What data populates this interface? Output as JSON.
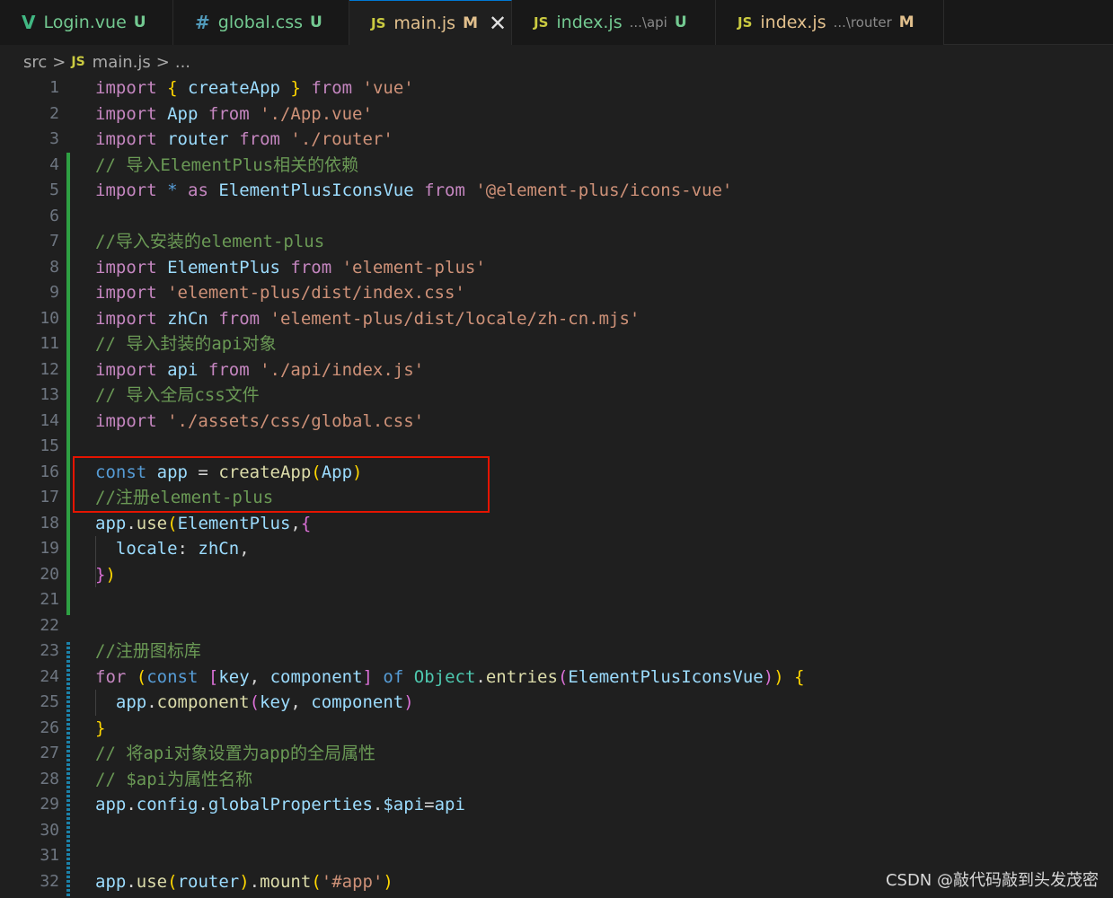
{
  "tabs": [
    {
      "icon": "vue-icon",
      "icon_text": "V",
      "name": "Login.vue",
      "path": "",
      "status": "U"
    },
    {
      "icon": "css-icon",
      "icon_text": "#",
      "name": "global.css",
      "path": "",
      "status": "U"
    },
    {
      "icon": "js-icon",
      "icon_text": "JS",
      "name": "main.js",
      "path": "",
      "status": "M",
      "active": true,
      "close": "✕"
    },
    {
      "icon": "js-icon",
      "icon_text": "JS",
      "name": "index.js",
      "path": "...\\api",
      "status": "U"
    },
    {
      "icon": "js-icon",
      "icon_text": "JS",
      "name": "index.js",
      "path": "...\\router",
      "status": "M"
    }
  ],
  "breadcrumb": {
    "root": "src",
    "sep": ">",
    "file_icon": "JS",
    "file": "main.js",
    "rest": "..."
  },
  "editor": {
    "language": "javascript",
    "lines": [
      [
        [
          "k",
          "import"
        ],
        [
          "o",
          " "
        ],
        [
          "b1",
          "{"
        ],
        [
          "o",
          " "
        ],
        [
          "v",
          "createApp"
        ],
        [
          "o",
          " "
        ],
        [
          "b1",
          "}"
        ],
        [
          "o",
          " "
        ],
        [
          "k",
          "from"
        ],
        [
          "o",
          " "
        ],
        [
          "s",
          "'vue'"
        ]
      ],
      [
        [
          "k",
          "import"
        ],
        [
          "o",
          " "
        ],
        [
          "v",
          "App"
        ],
        [
          "o",
          " "
        ],
        [
          "k",
          "from"
        ],
        [
          "o",
          " "
        ],
        [
          "s",
          "'./App.vue'"
        ]
      ],
      [
        [
          "k",
          "import"
        ],
        [
          "o",
          " "
        ],
        [
          "v",
          "router"
        ],
        [
          "o",
          " "
        ],
        [
          "k",
          "from"
        ],
        [
          "o",
          " "
        ],
        [
          "s",
          "'./router'"
        ]
      ],
      [
        [
          "c",
          "// 导入ElementPlus相关的依赖"
        ]
      ],
      [
        [
          "k",
          "import"
        ],
        [
          "o",
          " "
        ],
        [
          "d",
          "*"
        ],
        [
          "o",
          " "
        ],
        [
          "k",
          "as"
        ],
        [
          "o",
          " "
        ],
        [
          "v",
          "ElementPlusIconsVue"
        ],
        [
          "o",
          " "
        ],
        [
          "k",
          "from"
        ],
        [
          "o",
          " "
        ],
        [
          "s",
          "'@element-plus/icons-vue'"
        ]
      ],
      [],
      [
        [
          "c",
          "//导入安装的element-plus"
        ]
      ],
      [
        [
          "k",
          "import"
        ],
        [
          "o",
          " "
        ],
        [
          "v",
          "ElementPlus"
        ],
        [
          "o",
          " "
        ],
        [
          "k",
          "from"
        ],
        [
          "o",
          " "
        ],
        [
          "s",
          "'element-plus'"
        ]
      ],
      [
        [
          "k",
          "import"
        ],
        [
          "o",
          " "
        ],
        [
          "s",
          "'element-plus/dist/index.css'"
        ]
      ],
      [
        [
          "k",
          "import"
        ],
        [
          "o",
          " "
        ],
        [
          "v",
          "zhCn"
        ],
        [
          "o",
          " "
        ],
        [
          "k",
          "from"
        ],
        [
          "o",
          " "
        ],
        [
          "s",
          "'element-plus/dist/locale/zh-cn.mjs'"
        ]
      ],
      [
        [
          "c",
          "// 导入封装的api对象"
        ]
      ],
      [
        [
          "k",
          "import"
        ],
        [
          "o",
          " "
        ],
        [
          "v",
          "api"
        ],
        [
          "o",
          " "
        ],
        [
          "k",
          "from"
        ],
        [
          "o",
          " "
        ],
        [
          "s",
          "'./api/index.js'"
        ]
      ],
      [
        [
          "c",
          "// 导入全局css文件"
        ]
      ],
      [
        [
          "k",
          "import"
        ],
        [
          "o",
          " "
        ],
        [
          "s",
          "'./assets/css/global.css'"
        ]
      ],
      [],
      [
        [
          "d",
          "const"
        ],
        [
          "o",
          " "
        ],
        [
          "v",
          "app"
        ],
        [
          "o",
          " = "
        ],
        [
          "f",
          "createApp"
        ],
        [
          "b1",
          "("
        ],
        [
          "v",
          "App"
        ],
        [
          "b1",
          ")"
        ]
      ],
      [
        [
          "c",
          "//注册element-plus"
        ]
      ],
      [
        [
          "v",
          "app"
        ],
        [
          "o",
          "."
        ],
        [
          "f",
          "use"
        ],
        [
          "b1",
          "("
        ],
        [
          "v",
          "ElementPlus"
        ],
        [
          "o",
          ","
        ],
        [
          "b2",
          "{"
        ]
      ],
      [
        [
          "o",
          "  "
        ],
        [
          "v",
          "locale"
        ],
        [
          "o",
          ": "
        ],
        [
          "v",
          "zhCn"
        ],
        [
          "o",
          ","
        ]
      ],
      [
        [
          "b2",
          "}"
        ],
        [
          "b1",
          ")"
        ]
      ],
      [],
      [],
      [
        [
          "c",
          "//注册图标库"
        ]
      ],
      [
        [
          "k",
          "for"
        ],
        [
          "o",
          " "
        ],
        [
          "b1",
          "("
        ],
        [
          "d",
          "const"
        ],
        [
          "o",
          " "
        ],
        [
          "b2",
          "["
        ],
        [
          "v",
          "key"
        ],
        [
          "o",
          ", "
        ],
        [
          "v",
          "component"
        ],
        [
          "b2",
          "]"
        ],
        [
          "o",
          " "
        ],
        [
          "d",
          "of"
        ],
        [
          "o",
          " "
        ],
        [
          "t",
          "Object"
        ],
        [
          "o",
          "."
        ],
        [
          "f",
          "entries"
        ],
        [
          "b2",
          "("
        ],
        [
          "v",
          "ElementPlusIconsVue"
        ],
        [
          "b2",
          ")"
        ],
        [
          "b1",
          ")"
        ],
        [
          "o",
          " "
        ],
        [
          "b1",
          "{"
        ]
      ],
      [
        [
          "o",
          "  "
        ],
        [
          "v",
          "app"
        ],
        [
          "o",
          "."
        ],
        [
          "f",
          "component"
        ],
        [
          "b2",
          "("
        ],
        [
          "v",
          "key"
        ],
        [
          "o",
          ", "
        ],
        [
          "v",
          "component"
        ],
        [
          "b2",
          ")"
        ]
      ],
      [
        [
          "b1",
          "}"
        ]
      ],
      [
        [
          "c",
          "// 将api对象设置为app的全局属性"
        ]
      ],
      [
        [
          "c",
          "// $api为属性名称"
        ]
      ],
      [
        [
          "v",
          "app"
        ],
        [
          "o",
          "."
        ],
        [
          "v",
          "config"
        ],
        [
          "o",
          "."
        ],
        [
          "v",
          "globalProperties"
        ],
        [
          "o",
          "."
        ],
        [
          "v",
          "$api"
        ],
        [
          "o",
          "="
        ],
        [
          "v",
          "api"
        ]
      ],
      [],
      [],
      [
        [
          "v",
          "app"
        ],
        [
          "o",
          "."
        ],
        [
          "f",
          "use"
        ],
        [
          "b1",
          "("
        ],
        [
          "v",
          "router"
        ],
        [
          "b1",
          ")"
        ],
        [
          "o",
          "."
        ],
        [
          "f",
          "mount"
        ],
        [
          "b1",
          "("
        ],
        [
          "s",
          "'#app'"
        ],
        [
          "b1",
          ")"
        ]
      ]
    ]
  },
  "watermark": "CSDN @敲代码敲到头发茂密",
  "colors": {
    "modified_gutter": "#2ea043",
    "added_gutter": "#1b81a8",
    "highlight_box": "#e51400",
    "accent": "#0078d4"
  }
}
